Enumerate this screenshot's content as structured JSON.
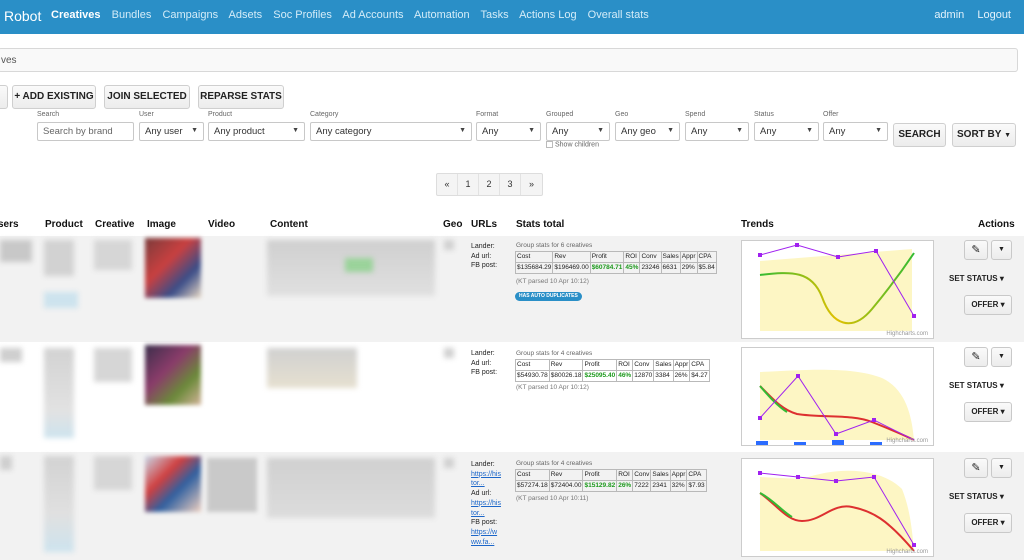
{
  "app": {
    "brand": "Robot",
    "nav": [
      "Creatives",
      "Bundles",
      "Campaigns",
      "Adsets",
      "Soc Profiles",
      "Ad Accounts",
      "Automation",
      "Tasks",
      "Actions Log",
      "Overall stats"
    ],
    "active_nav": "Creatives",
    "user": "admin",
    "logout": "Logout"
  },
  "breadcrumb": "ves",
  "toolbar": {
    "add_existing": "+ ADD EXISTING",
    "join_selected": "JOIN SELECTED",
    "reparse_stats": "REPARSE STATS"
  },
  "filters": {
    "search": {
      "label": "Search",
      "placeholder": "Search by brand"
    },
    "user": {
      "label": "User",
      "value": "Any user"
    },
    "product": {
      "label": "Product",
      "value": "Any product"
    },
    "category": {
      "label": "Category",
      "value": "Any category"
    },
    "format": {
      "label": "Format",
      "value": "Any"
    },
    "grouped": {
      "label": "Grouped",
      "value": "Any",
      "checkbox": "Show children"
    },
    "geo": {
      "label": "Geo",
      "value": "Any geo"
    },
    "spend": {
      "label": "Spend",
      "value": "Any"
    },
    "status": {
      "label": "Status",
      "value": "Any"
    },
    "offer": {
      "label": "Offer",
      "value": "Any"
    },
    "search_button": "SEARCH",
    "sort_button": "SORT BY"
  },
  "pagination": [
    "«",
    "1",
    "2",
    "3",
    "»"
  ],
  "table_headers": {
    "users": "sers",
    "product": "Product",
    "creative": "Creative",
    "image": "Image",
    "video": "Video",
    "content": "Content",
    "geo": "Geo",
    "urls": "URLs",
    "stats": "Stats total",
    "trends": "Trends",
    "actions": "Actions"
  },
  "stats_headers": [
    "Cost",
    "Rev",
    "Profit",
    "ROI",
    "Conv",
    "Sales",
    "Appr",
    "CPA"
  ],
  "rows": [
    {
      "url_labels": [
        "Lander:",
        "Ad url:",
        "FB post:"
      ],
      "group_title": "Group stats for 6 creatives",
      "stats": [
        "$135684.29",
        "$196469.00",
        "$60784.71",
        "45%",
        "23246",
        "6631",
        "29%",
        "$5.84"
      ],
      "parsed": "(KT parsed 10 Apr 10:12)",
      "badge": "HAS AUTO DUPLICATES"
    },
    {
      "url_labels": [
        "Lander:",
        "Ad url:",
        "FB post:"
      ],
      "group_title": "Group stats for 4 creatives",
      "stats": [
        "$54930.78",
        "$80026.18",
        "$25095.40",
        "46%",
        "12870",
        "3384",
        "26%",
        "$4.27"
      ],
      "parsed": "(KT parsed 10 Apr 10:12)"
    },
    {
      "url_labels": [
        "Lander:",
        "Ad url:",
        "FB post:"
      ],
      "url_links": [
        "https://his",
        "tor...",
        "https://his",
        "tor...",
        "https://w",
        "ww.fa..."
      ],
      "group_title": "Group stats for 4 creatives",
      "stats": [
        "$57274.18",
        "$72404.00",
        "$15129.82",
        "26%",
        "7222",
        "2341",
        "32%",
        "$7.93"
      ],
      "parsed": "(KT parsed 10 Apr 10:11)"
    }
  ],
  "row_actions": {
    "set_status": "SET STATUS",
    "offer": "OFFER"
  },
  "trend_credit": "Highcharts.com",
  "colors": {
    "header": "#2a8fc7",
    "profit": "#1d9a1d",
    "link": "#1b66c9",
    "purple": "#a020f0",
    "trend_band": "#fdf6c4"
  }
}
